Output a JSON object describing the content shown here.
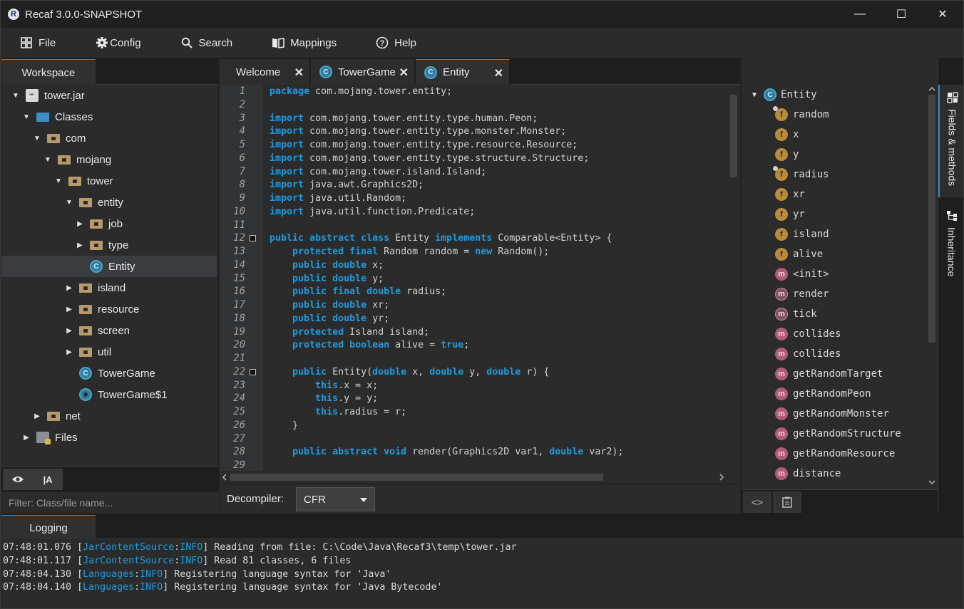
{
  "window": {
    "title": "Recaf 3.0.0-SNAPSHOT",
    "icon": "recaf-logo-icon"
  },
  "window_controls": {
    "minimize": "—",
    "maximize": "☐",
    "close": "✕"
  },
  "menu": [
    {
      "label": "File",
      "icon": "grid-icon"
    },
    {
      "label": "Config",
      "icon": "gear-icon"
    },
    {
      "label": "Search",
      "icon": "search-icon"
    },
    {
      "label": "Mappings",
      "icon": "book-icon"
    },
    {
      "label": "Help",
      "icon": "help-circle-icon"
    }
  ],
  "workspace": {
    "tab": "Workspace",
    "tree": [
      {
        "label": "tower.jar",
        "type": "jar",
        "expanded": true
      },
      {
        "label": "Classes",
        "type": "folder-classes",
        "expanded": true
      },
      {
        "label": "com",
        "type": "folder",
        "expanded": true
      },
      {
        "label": "mojang",
        "type": "folder",
        "expanded": true
      },
      {
        "label": "tower",
        "type": "folder",
        "expanded": true
      },
      {
        "label": "entity",
        "type": "folder",
        "expanded": true
      },
      {
        "label": "job",
        "type": "folder",
        "expanded": false
      },
      {
        "label": "type",
        "type": "folder",
        "expanded": false
      },
      {
        "label": "Entity",
        "type": "class",
        "selected": true
      },
      {
        "label": "island",
        "type": "folder",
        "expanded": false
      },
      {
        "label": "resource",
        "type": "folder",
        "expanded": false
      },
      {
        "label": "screen",
        "type": "folder",
        "expanded": false
      },
      {
        "label": "util",
        "type": "folder",
        "expanded": false
      },
      {
        "label": "TowerGame",
        "type": "class"
      },
      {
        "label": "TowerGame$1",
        "type": "class-anon"
      },
      {
        "label": "net",
        "type": "folder",
        "expanded": false
      },
      {
        "label": "Files",
        "type": "files",
        "expanded": false
      }
    ],
    "tools": {
      "eye": "eye-icon",
      "case": "case-sensitive-icon"
    },
    "filter_placeholder": "Filter: Class/file name..."
  },
  "editor_tabs": [
    {
      "label": "Welcome",
      "icon": "",
      "close": "✕"
    },
    {
      "label": "TowerGame",
      "icon": "class-icon",
      "close": "✕"
    },
    {
      "label": "Entity",
      "icon": "class-icon",
      "close": "✕",
      "active": true
    }
  ],
  "code": {
    "lines": [
      [
        {
          "t": "package",
          "k": 1
        },
        {
          "t": " com.mojang.tower.entity;"
        }
      ],
      [],
      [
        {
          "t": "import",
          "k": 1
        },
        {
          "t": " com.mojang.tower.entity.type.human.Peon;"
        }
      ],
      [
        {
          "t": "import",
          "k": 1
        },
        {
          "t": " com.mojang.tower.entity.type.monster.Monster;"
        }
      ],
      [
        {
          "t": "import",
          "k": 1
        },
        {
          "t": " com.mojang.tower.entity.type.resource.Resource;"
        }
      ],
      [
        {
          "t": "import",
          "k": 1
        },
        {
          "t": " com.mojang.tower.entity.type.structure.Structure;"
        }
      ],
      [
        {
          "t": "import",
          "k": 1
        },
        {
          "t": " com.mojang.tower.island.Island;"
        }
      ],
      [
        {
          "t": "import",
          "k": 1
        },
        {
          "t": " java.awt.Graphics2D;"
        }
      ],
      [
        {
          "t": "import",
          "k": 1
        },
        {
          "t": " java.util.Random;"
        }
      ],
      [
        {
          "t": "import",
          "k": 1
        },
        {
          "t": " java.util.function.Predicate;"
        }
      ],
      [],
      [
        {
          "t": "public abstract class",
          "k": 1
        },
        {
          "t": " Entity "
        },
        {
          "t": "implements",
          "k": 1
        },
        {
          "t": " Comparable<Entity> {"
        }
      ],
      [
        {
          "t": "    "
        },
        {
          "t": "protected final",
          "k": 1
        },
        {
          "t": " Random random = "
        },
        {
          "t": "new",
          "k": 1
        },
        {
          "t": " Random();"
        }
      ],
      [
        {
          "t": "    "
        },
        {
          "t": "public double",
          "k": 1
        },
        {
          "t": " x;"
        }
      ],
      [
        {
          "t": "    "
        },
        {
          "t": "public double",
          "k": 1
        },
        {
          "t": " y;"
        }
      ],
      [
        {
          "t": "    "
        },
        {
          "t": "public final double",
          "k": 1
        },
        {
          "t": " radius;"
        }
      ],
      [
        {
          "t": "    "
        },
        {
          "t": "public double",
          "k": 1
        },
        {
          "t": " xr;"
        }
      ],
      [
        {
          "t": "    "
        },
        {
          "t": "public double",
          "k": 1
        },
        {
          "t": " yr;"
        }
      ],
      [
        {
          "t": "    "
        },
        {
          "t": "protected",
          "k": 1
        },
        {
          "t": " Island island;"
        }
      ],
      [
        {
          "t": "    "
        },
        {
          "t": "protected boolean",
          "k": 1
        },
        {
          "t": " alive = "
        },
        {
          "t": "true",
          "k": 1
        },
        {
          "t": ";"
        }
      ],
      [],
      [
        {
          "t": "    "
        },
        {
          "t": "public",
          "k": 1
        },
        {
          "t": " Entity("
        },
        {
          "t": "double",
          "k": 1
        },
        {
          "t": " x, "
        },
        {
          "t": "double",
          "k": 1
        },
        {
          "t": " y, "
        },
        {
          "t": "double",
          "k": 1
        },
        {
          "t": " r) {"
        }
      ],
      [
        {
          "t": "        "
        },
        {
          "t": "this",
          "k": 1
        },
        {
          "t": ".x = x;"
        }
      ],
      [
        {
          "t": "        "
        },
        {
          "t": "this",
          "k": 1
        },
        {
          "t": ".y = y;"
        }
      ],
      [
        {
          "t": "        "
        },
        {
          "t": "this",
          "k": 1
        },
        {
          "t": ".radius = r;"
        }
      ],
      [
        {
          "t": "    }"
        }
      ],
      [],
      [
        {
          "t": "    "
        },
        {
          "t": "public abstract void",
          "k": 1
        },
        {
          "t": " render(Graphics2D var1, "
        },
        {
          "t": "double",
          "k": 1
        },
        {
          "t": " var2);"
        }
      ],
      []
    ],
    "line_numbers": [
      "1",
      "2",
      "3",
      "4",
      "5",
      "6",
      "7",
      "8",
      "9",
      "10",
      "11",
      "12",
      "13",
      "14",
      "15",
      "16",
      "17",
      "18",
      "19",
      "20",
      "21",
      "22",
      "23",
      "24",
      "25",
      "26",
      "27",
      "28",
      "29"
    ],
    "fold_markers": [
      "12",
      "22"
    ]
  },
  "decompiler": {
    "label": "Decompiler:",
    "value": "CFR"
  },
  "members": {
    "root": "Entity",
    "items": [
      {
        "label": "random",
        "kind": "field",
        "mod": "final"
      },
      {
        "label": "x",
        "kind": "field"
      },
      {
        "label": "y",
        "kind": "field"
      },
      {
        "label": "radius",
        "kind": "field",
        "mod": "final"
      },
      {
        "label": "xr",
        "kind": "field"
      },
      {
        "label": "yr",
        "kind": "field"
      },
      {
        "label": "island",
        "kind": "field"
      },
      {
        "label": "alive",
        "kind": "field"
      },
      {
        "label": "<init>",
        "kind": "method"
      },
      {
        "label": "render",
        "kind": "method-abstract"
      },
      {
        "label": "tick",
        "kind": "method-abstract"
      },
      {
        "label": "collides",
        "kind": "method"
      },
      {
        "label": "collides",
        "kind": "method"
      },
      {
        "label": "getRandomTarget",
        "kind": "method"
      },
      {
        "label": "getRandomPeon",
        "kind": "method"
      },
      {
        "label": "getRandomMonster",
        "kind": "method"
      },
      {
        "label": "getRandomStructure",
        "kind": "method"
      },
      {
        "label": "getRandomResource",
        "kind": "method"
      },
      {
        "label": "distance",
        "kind": "method"
      }
    ],
    "tools": {
      "code": "code-brackets-icon",
      "clipboard": "clipboard-icon"
    }
  },
  "side_tabs": [
    {
      "label": "Fields & methods",
      "icon": "fields-methods-icon"
    },
    {
      "label": "Inheritance",
      "icon": "hierarchy-icon"
    }
  ],
  "logging": {
    "tab": "Logging",
    "lines": [
      {
        "time": "07:48:01.076",
        "source": "JarContentSource",
        "level": "INFO",
        "msg": "Reading from file: C:\\Code\\Java\\Recaf3\\temp\\tower.jar"
      },
      {
        "time": "07:48:01.117",
        "source": "JarContentSource",
        "level": "INFO",
        "msg": "Read 81 classes, 6 files"
      },
      {
        "time": "07:48:04.130",
        "source": "Languages",
        "level": "INFO",
        "msg": "Registering language syntax for 'Java'"
      },
      {
        "time": "07:48:04.140",
        "source": "Languages",
        "level": "INFO",
        "msg": "Registering language syntax for 'Java Bytecode'"
      }
    ]
  }
}
